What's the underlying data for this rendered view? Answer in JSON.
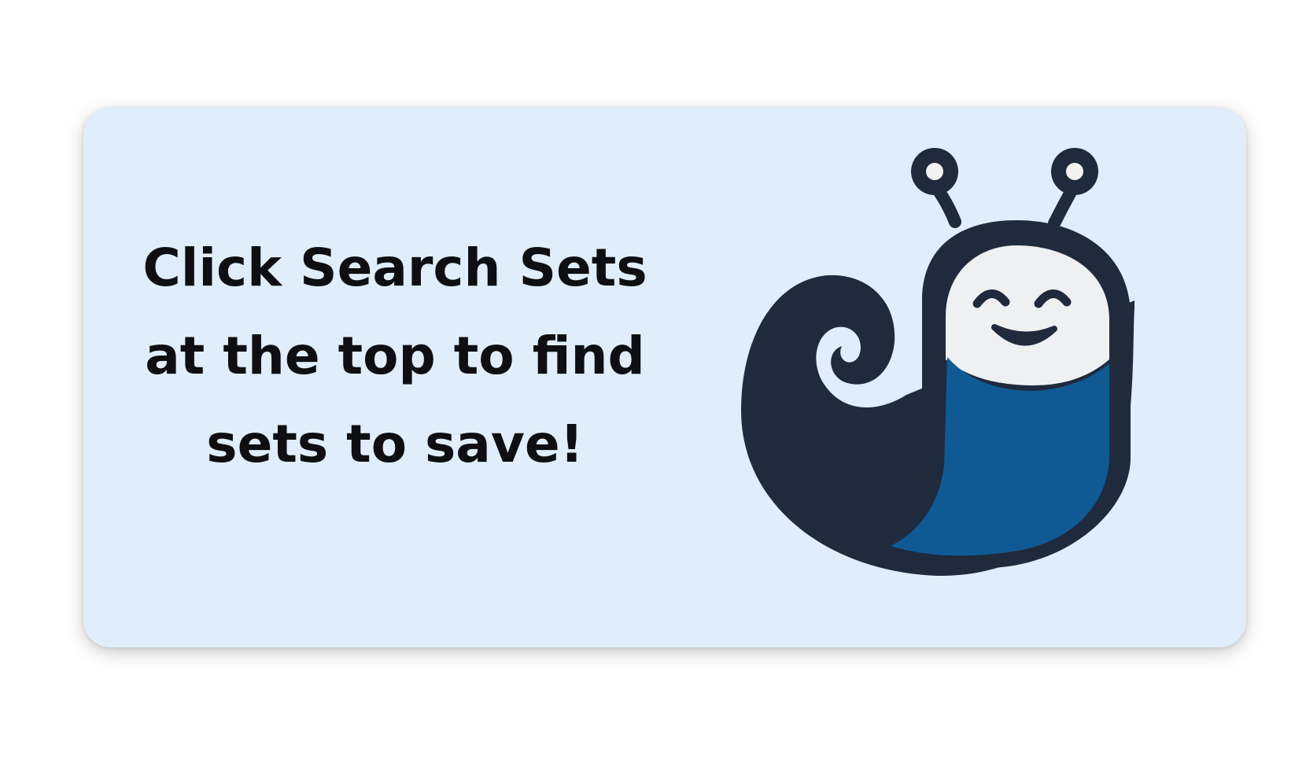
{
  "card": {
    "message_lines": [
      "Click Search Sets",
      "at the top to find",
      "sets to save!"
    ]
  },
  "mascot": {
    "icon": "snail-mascot-icon"
  },
  "colors": {
    "card_background": "#dfeefa",
    "text": "#0e0f12",
    "snail_body": "#1f2a3c",
    "snail_belly": "#0f5a94",
    "snail_face": "#eef0f2"
  }
}
